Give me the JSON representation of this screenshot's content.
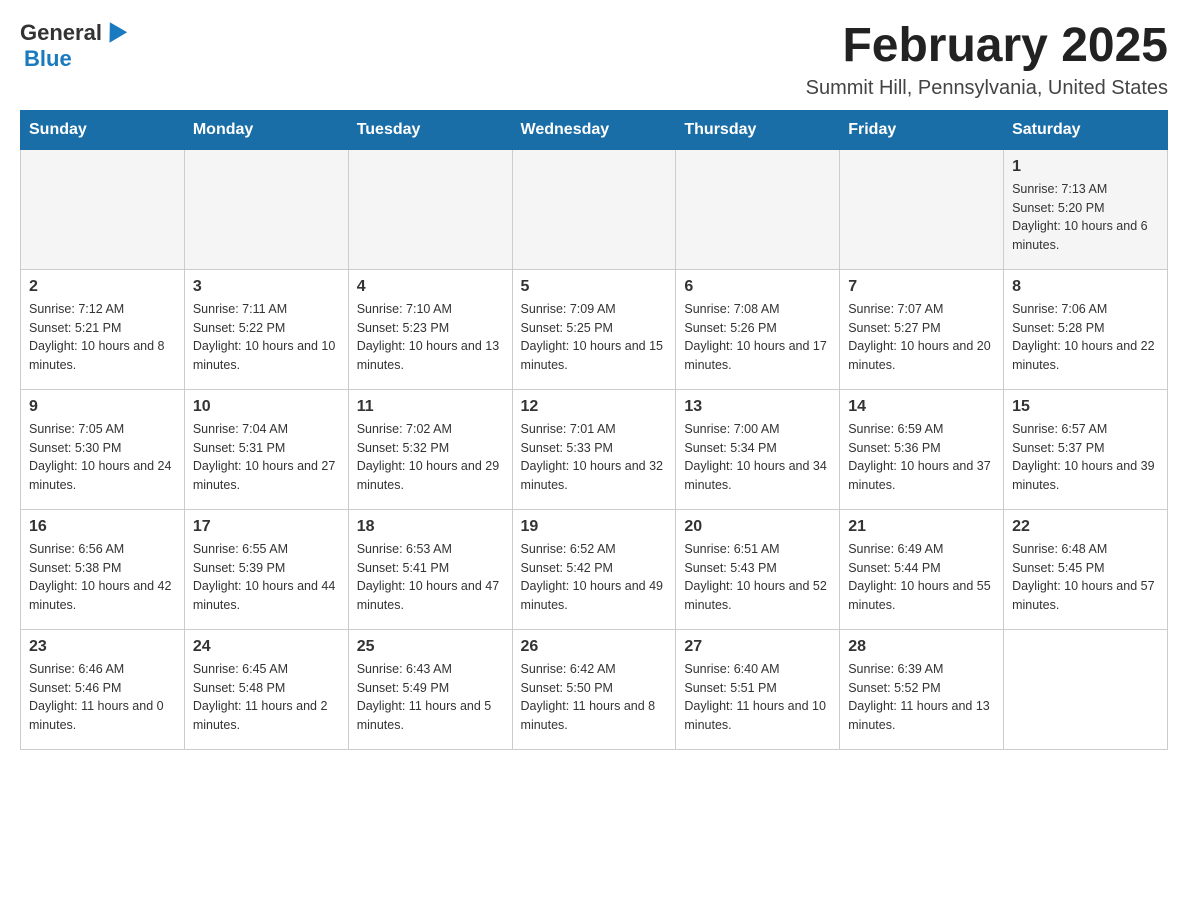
{
  "logo": {
    "general": "General",
    "blue": "Blue"
  },
  "title": "February 2025",
  "subtitle": "Summit Hill, Pennsylvania, United States",
  "days_header": [
    "Sunday",
    "Monday",
    "Tuesday",
    "Wednesday",
    "Thursday",
    "Friday",
    "Saturday"
  ],
  "weeks": [
    [
      {
        "day": "",
        "info": ""
      },
      {
        "day": "",
        "info": ""
      },
      {
        "day": "",
        "info": ""
      },
      {
        "day": "",
        "info": ""
      },
      {
        "day": "",
        "info": ""
      },
      {
        "day": "",
        "info": ""
      },
      {
        "day": "1",
        "info": "Sunrise: 7:13 AM\nSunset: 5:20 PM\nDaylight: 10 hours and 6 minutes."
      }
    ],
    [
      {
        "day": "2",
        "info": "Sunrise: 7:12 AM\nSunset: 5:21 PM\nDaylight: 10 hours and 8 minutes."
      },
      {
        "day": "3",
        "info": "Sunrise: 7:11 AM\nSunset: 5:22 PM\nDaylight: 10 hours and 10 minutes."
      },
      {
        "day": "4",
        "info": "Sunrise: 7:10 AM\nSunset: 5:23 PM\nDaylight: 10 hours and 13 minutes."
      },
      {
        "day": "5",
        "info": "Sunrise: 7:09 AM\nSunset: 5:25 PM\nDaylight: 10 hours and 15 minutes."
      },
      {
        "day": "6",
        "info": "Sunrise: 7:08 AM\nSunset: 5:26 PM\nDaylight: 10 hours and 17 minutes."
      },
      {
        "day": "7",
        "info": "Sunrise: 7:07 AM\nSunset: 5:27 PM\nDaylight: 10 hours and 20 minutes."
      },
      {
        "day": "8",
        "info": "Sunrise: 7:06 AM\nSunset: 5:28 PM\nDaylight: 10 hours and 22 minutes."
      }
    ],
    [
      {
        "day": "9",
        "info": "Sunrise: 7:05 AM\nSunset: 5:30 PM\nDaylight: 10 hours and 24 minutes."
      },
      {
        "day": "10",
        "info": "Sunrise: 7:04 AM\nSunset: 5:31 PM\nDaylight: 10 hours and 27 minutes."
      },
      {
        "day": "11",
        "info": "Sunrise: 7:02 AM\nSunset: 5:32 PM\nDaylight: 10 hours and 29 minutes."
      },
      {
        "day": "12",
        "info": "Sunrise: 7:01 AM\nSunset: 5:33 PM\nDaylight: 10 hours and 32 minutes."
      },
      {
        "day": "13",
        "info": "Sunrise: 7:00 AM\nSunset: 5:34 PM\nDaylight: 10 hours and 34 minutes."
      },
      {
        "day": "14",
        "info": "Sunrise: 6:59 AM\nSunset: 5:36 PM\nDaylight: 10 hours and 37 minutes."
      },
      {
        "day": "15",
        "info": "Sunrise: 6:57 AM\nSunset: 5:37 PM\nDaylight: 10 hours and 39 minutes."
      }
    ],
    [
      {
        "day": "16",
        "info": "Sunrise: 6:56 AM\nSunset: 5:38 PM\nDaylight: 10 hours and 42 minutes."
      },
      {
        "day": "17",
        "info": "Sunrise: 6:55 AM\nSunset: 5:39 PM\nDaylight: 10 hours and 44 minutes."
      },
      {
        "day": "18",
        "info": "Sunrise: 6:53 AM\nSunset: 5:41 PM\nDaylight: 10 hours and 47 minutes."
      },
      {
        "day": "19",
        "info": "Sunrise: 6:52 AM\nSunset: 5:42 PM\nDaylight: 10 hours and 49 minutes."
      },
      {
        "day": "20",
        "info": "Sunrise: 6:51 AM\nSunset: 5:43 PM\nDaylight: 10 hours and 52 minutes."
      },
      {
        "day": "21",
        "info": "Sunrise: 6:49 AM\nSunset: 5:44 PM\nDaylight: 10 hours and 55 minutes."
      },
      {
        "day": "22",
        "info": "Sunrise: 6:48 AM\nSunset: 5:45 PM\nDaylight: 10 hours and 57 minutes."
      }
    ],
    [
      {
        "day": "23",
        "info": "Sunrise: 6:46 AM\nSunset: 5:46 PM\nDaylight: 11 hours and 0 minutes."
      },
      {
        "day": "24",
        "info": "Sunrise: 6:45 AM\nSunset: 5:48 PM\nDaylight: 11 hours and 2 minutes."
      },
      {
        "day": "25",
        "info": "Sunrise: 6:43 AM\nSunset: 5:49 PM\nDaylight: 11 hours and 5 minutes."
      },
      {
        "day": "26",
        "info": "Sunrise: 6:42 AM\nSunset: 5:50 PM\nDaylight: 11 hours and 8 minutes."
      },
      {
        "day": "27",
        "info": "Sunrise: 6:40 AM\nSunset: 5:51 PM\nDaylight: 11 hours and 10 minutes."
      },
      {
        "day": "28",
        "info": "Sunrise: 6:39 AM\nSunset: 5:52 PM\nDaylight: 11 hours and 13 minutes."
      },
      {
        "day": "",
        "info": ""
      }
    ]
  ]
}
